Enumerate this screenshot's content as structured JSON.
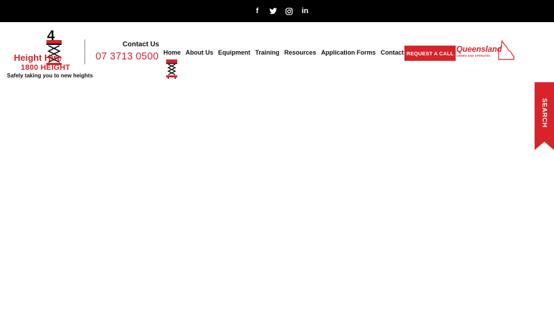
{
  "social": {
    "facebook": "f",
    "twitter": "t",
    "instagram": "◎",
    "linkedin": "in"
  },
  "logo": {
    "brand": "Height   Hire",
    "phone": "1800 HEIGHT",
    "tagline": "Safely taking you to new heights"
  },
  "contact": {
    "label": "Contact Us",
    "phone": "07 3713 0500"
  },
  "nav": {
    "items": [
      "Home",
      "About Us",
      "Equipment",
      "Training",
      "Resources",
      "Application Forms",
      "Contact"
    ]
  },
  "request_button": "REQUEST A CALL",
  "qld": {
    "title": "Queensland",
    "subtitle": "OWNED AND OPERATED"
  },
  "search_tab": "SEARCH",
  "colors": {
    "accent": "#d8232a",
    "topbar": "#000000"
  }
}
